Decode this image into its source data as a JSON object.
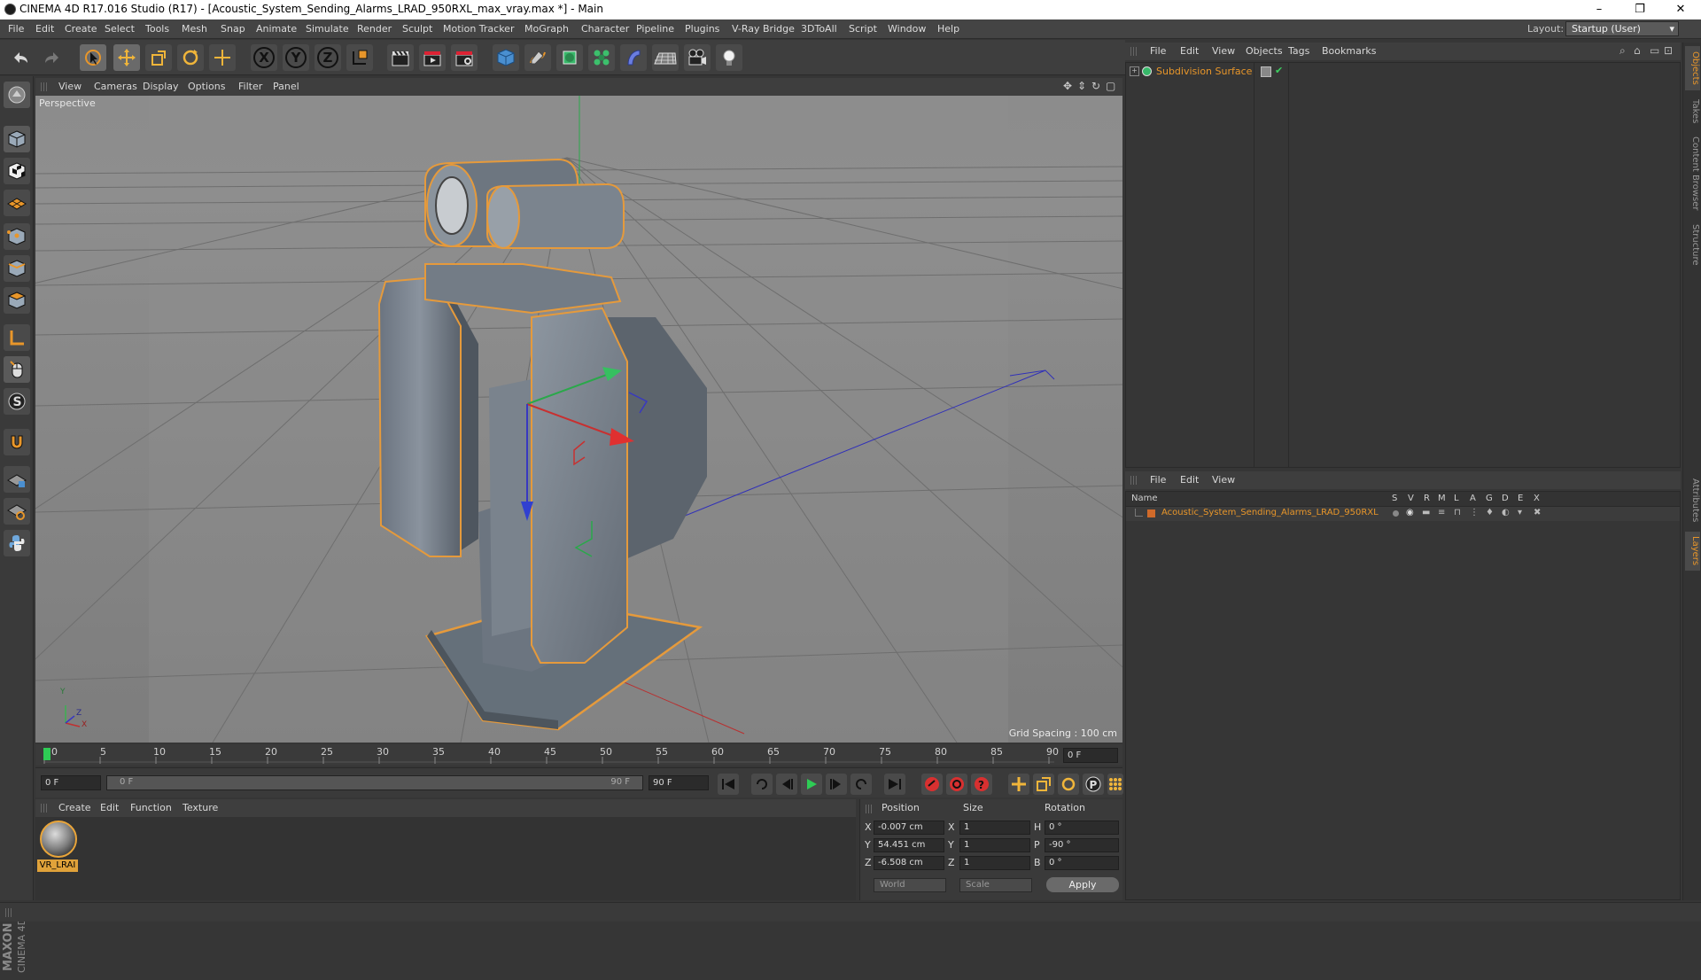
{
  "window": {
    "title": "CINEMA 4D R17.016 Studio (R17) - [Acoustic_System_Sending_Alarms_LRAD_950RXL_max_vray.max *] - Main",
    "minimize": "–",
    "restore": "❐",
    "close": "✕"
  },
  "menubar": {
    "items": [
      "File",
      "Edit",
      "Create",
      "Select",
      "Tools",
      "Mesh",
      "Snap",
      "Animate",
      "Simulate",
      "Render",
      "Sculpt",
      "Motion Tracker",
      "MoGraph",
      "Character",
      "Pipeline",
      "Plugins",
      "V-Ray Bridge",
      "3DToAll",
      "Script",
      "Window",
      "Help"
    ],
    "layout_label": "Layout:",
    "layout_value": "Startup (User)"
  },
  "toolbar": {
    "axis_x": "X",
    "axis_y": "Y",
    "axis_z": "Z"
  },
  "viewport": {
    "menu": [
      "View",
      "Cameras",
      "Display",
      "Options",
      "Filter",
      "Panel"
    ],
    "camera_label": "Perspective",
    "grid_spacing": "Grid Spacing : 100 cm",
    "axis_y": "Y",
    "axis_x": "X",
    "axis_z": "Z"
  },
  "timeline": {
    "ticks": [
      "0",
      "5",
      "10",
      "15",
      "20",
      "25",
      "30",
      "35",
      "40",
      "45",
      "50",
      "55",
      "60",
      "65",
      "70",
      "75",
      "80",
      "85",
      "90"
    ],
    "current_frame_field": "0 F",
    "start_field": "0 F",
    "range_start": "0 F",
    "range_end": "90 F",
    "end_field": "90 F"
  },
  "material_manager": {
    "menu": [
      "Create",
      "Edit",
      "Function",
      "Texture"
    ],
    "material_name": "VR_LRAI"
  },
  "coordinates": {
    "headers": [
      "Position",
      "Size",
      "Rotation"
    ],
    "rows": [
      {
        "axis": "X",
        "position": "-0.007 cm",
        "size_axis": "X",
        "size": "1",
        "rot_axis": "H",
        "rotation": "0 °"
      },
      {
        "axis": "Y",
        "position": "54.451 cm",
        "size_axis": "Y",
        "size": "1",
        "rot_axis": "P",
        "rotation": "-90 °"
      },
      {
        "axis": "Z",
        "position": "-6.508 cm",
        "size_axis": "Z",
        "size": "1",
        "rot_axis": "B",
        "rotation": "0 °"
      }
    ],
    "mode": "World",
    "size_mode": "Scale",
    "apply": "Apply"
  },
  "object_manager": {
    "menu": [
      "File",
      "Edit",
      "View",
      "Objects",
      "Tags",
      "Bookmarks"
    ],
    "object_name": "Subdivision Surface"
  },
  "layer_manager": {
    "menu": [
      "File",
      "Edit",
      "View"
    ],
    "columns": [
      "Name",
      "S",
      "V",
      "R",
      "M",
      "L",
      "A",
      "G",
      "D",
      "E",
      "X"
    ],
    "layer_name": "Acoustic_System_Sending_Alarms_LRAD_950RXL"
  },
  "right_tabs": [
    "Objects",
    "Takes",
    "Content Browser",
    "Structure",
    "Attributes",
    "Layers"
  ],
  "branding": {
    "logo_text_1": "MAXON",
    "logo_text_2": "CINEMA 4D"
  },
  "colors": {
    "accent": "#e8962a",
    "selection_outline": "#e59a3c",
    "viewport_bg": "#878787"
  }
}
